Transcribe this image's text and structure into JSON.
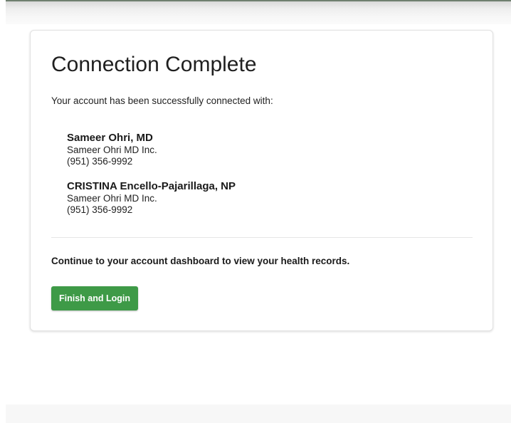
{
  "card": {
    "title": "Connection Complete",
    "intro": "Your account has been successfully connected with:",
    "providers": [
      {
        "name": "Sameer Ohri, MD",
        "practice": "Sameer Ohri MD Inc.",
        "phone": "(951) 356-9992"
      },
      {
        "name": "CRISTINA Encello-Pajarillaga, NP",
        "practice": "Sameer Ohri MD Inc.",
        "phone": "(951) 356-9992"
      }
    ],
    "continue_text": "Continue to your account dashboard to view your health records.",
    "finish_button_label": "Finish and Login"
  },
  "colors": {
    "button_green": "#3e9a47",
    "card_border": "#e2e2e2",
    "text_dark": "#1a1a1a"
  }
}
